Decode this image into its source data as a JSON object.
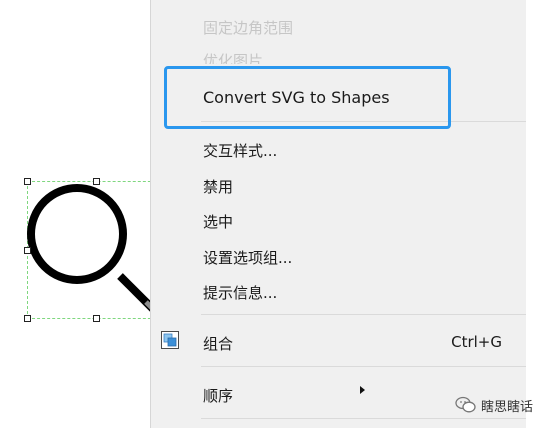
{
  "menu": {
    "items": [
      {
        "label": "固定边角范围",
        "disabled": true
      },
      {
        "label": "优化图片",
        "disabled": true
      },
      {
        "label": "Convert SVG to Shapes",
        "highlighted": true
      },
      {
        "label": "交互样式..."
      },
      {
        "label": "禁用"
      },
      {
        "label": "选中"
      },
      {
        "label": "设置选项组..."
      },
      {
        "label": "提示信息..."
      },
      {
        "label": "组合",
        "shortcut": "Ctrl+G"
      },
      {
        "label": "顺序",
        "has_submenu": true
      }
    ]
  },
  "watermark": {
    "text": "瞎思瞎话"
  },
  "colors": {
    "highlight_border": "#2a97ee",
    "selection_border": "#7fd77f",
    "menu_background": "#f0f0f0",
    "disabled_text": "#c6c6c6"
  },
  "icons": {
    "canvas_shape": "magnifier-icon",
    "group": "group-icon",
    "submenu": "submenu-arrow-icon",
    "watermark": "wechat-icon"
  }
}
